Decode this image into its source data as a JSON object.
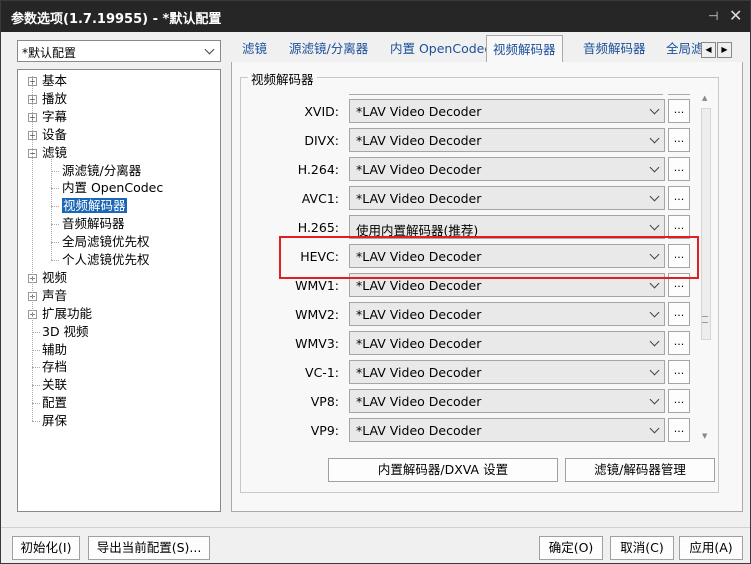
{
  "window": {
    "title": "参数选项(1.7.19955) - *默认配置",
    "pin_glyph": "⊣",
    "close_glyph": "✕"
  },
  "profile": {
    "value": "*默认配置"
  },
  "tree": {
    "items": [
      {
        "label": "基本",
        "expandable": true
      },
      {
        "label": "播放",
        "expandable": true
      },
      {
        "label": "字幕",
        "expandable": true
      },
      {
        "label": "设备",
        "expandable": true
      },
      {
        "label": "滤镜",
        "expanded": true
      },
      {
        "label": "源滤镜/分离器"
      },
      {
        "label": "内置 OpenCodec"
      },
      {
        "label": "视频解码器",
        "selected": true
      },
      {
        "label": "音频解码器"
      },
      {
        "label": "全局滤镜优先权"
      },
      {
        "label": "个人滤镜优先权"
      },
      {
        "label": "视频",
        "expandable": true
      },
      {
        "label": "声音",
        "expandable": true
      },
      {
        "label": "扩展功能",
        "expandable": true
      },
      {
        "label": "3D 视频"
      },
      {
        "label": "辅助"
      },
      {
        "label": "存档"
      },
      {
        "label": "关联"
      },
      {
        "label": "配置"
      },
      {
        "label": "屏保"
      }
    ]
  },
  "tabs": [
    "滤镜",
    "源滤镜/分离器",
    "内置 OpenCodec",
    "视频解码器",
    "音频解码器",
    "全局滤"
  ],
  "active_tab": "视频解码器",
  "tab_scroll": {
    "left": "◀",
    "right": "▶"
  },
  "group": {
    "label": "视频解码器"
  },
  "decoders": [
    {
      "label": "XVID:",
      "value": "*LAV Video Decoder"
    },
    {
      "label": "DIVX:",
      "value": "*LAV Video Decoder"
    },
    {
      "label": "H.264:",
      "value": "*LAV Video Decoder"
    },
    {
      "label": "AVC1:",
      "value": "*LAV Video Decoder"
    },
    {
      "label": "H.265:",
      "value": "使用内置解码器(推荐)"
    },
    {
      "label": "HEVC:",
      "value": "*LAV Video Decoder",
      "highlighted": true
    },
    {
      "label": "WMV1:",
      "value": "*LAV Video Decoder"
    },
    {
      "label": "WMV2:",
      "value": "*LAV Video Decoder"
    },
    {
      "label": "WMV3:",
      "value": "*LAV Video Decoder"
    },
    {
      "label": "VC-1:",
      "value": "*LAV Video Decoder"
    },
    {
      "label": "VP8:",
      "value": "*LAV Video Decoder"
    },
    {
      "label": "VP9:",
      "value": "*LAV Video Decoder"
    }
  ],
  "more_button": "...",
  "highlight_color": "#e02020",
  "panel_buttons": {
    "dxva": "内置解码器/DXVA 设置",
    "manage": "滤镜/解码器管理"
  },
  "footer": {
    "init": "初始化(I)",
    "export": "导出当前配置(S)...",
    "ok": "确定(O)",
    "cancel": "取消(C)",
    "apply": "应用(A)"
  }
}
